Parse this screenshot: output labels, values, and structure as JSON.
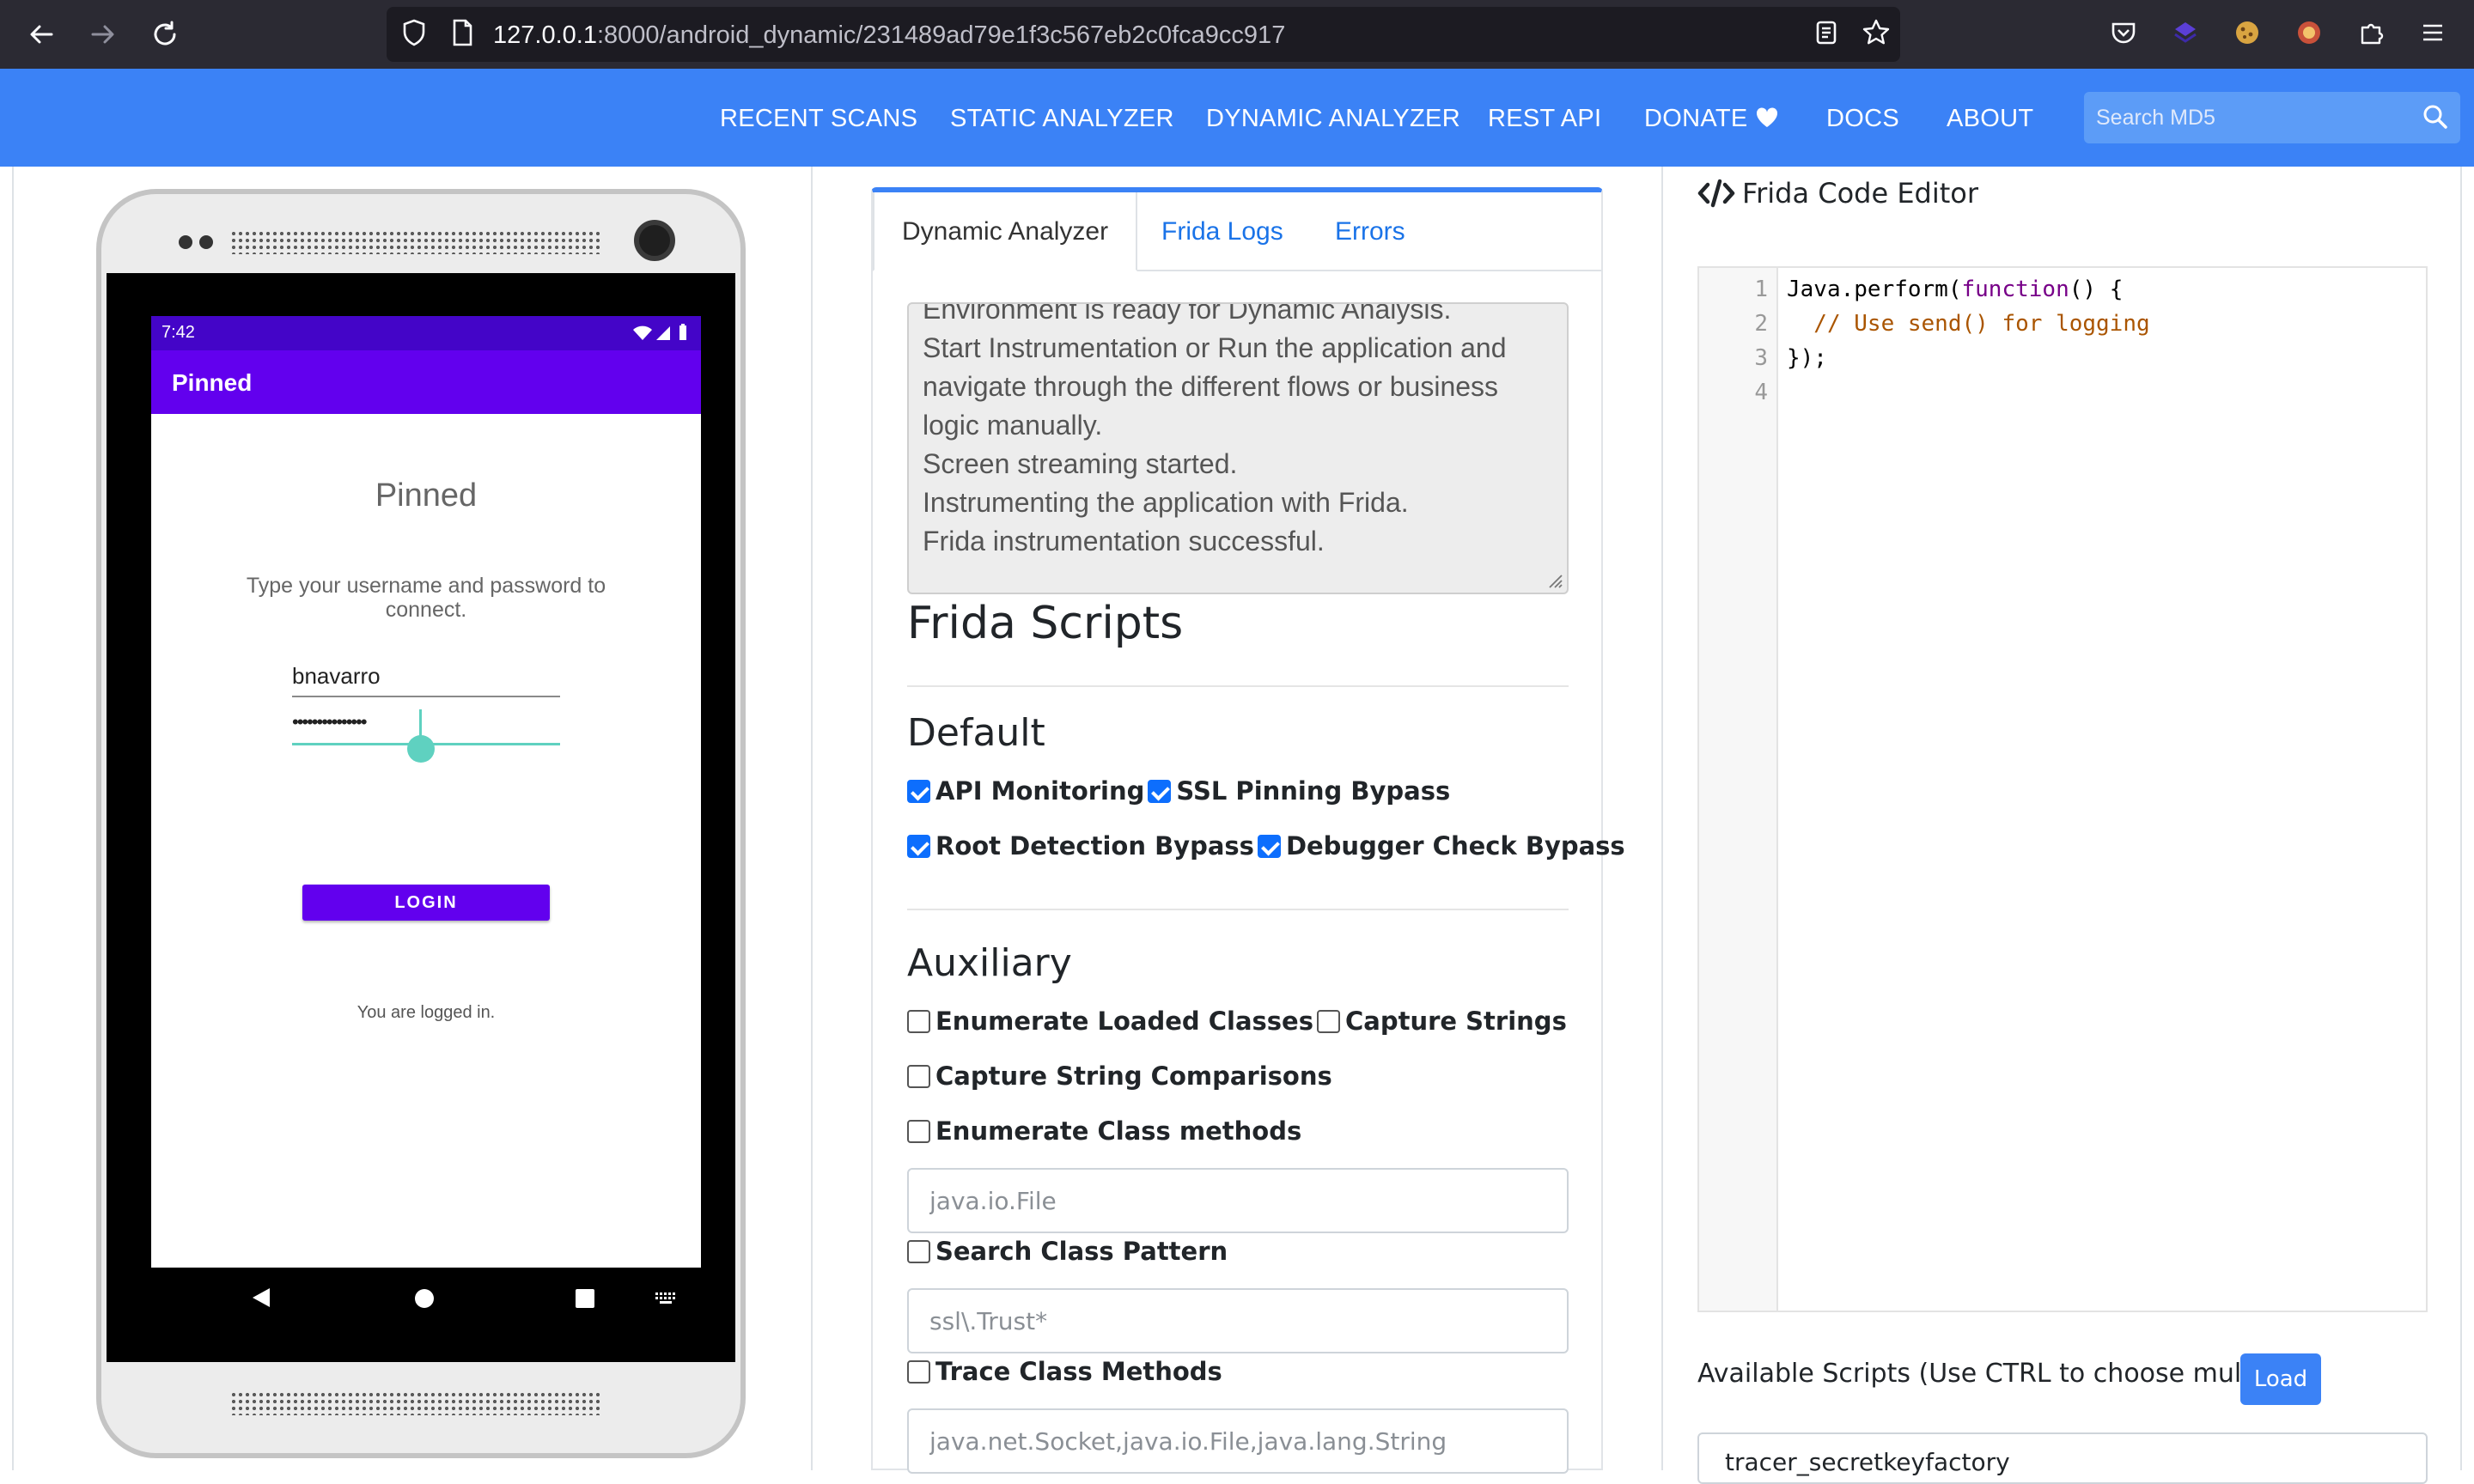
{
  "browser": {
    "url_host": "127.0.0.1",
    "url_path": ":8000/android_dynamic/231489ad79e1f3c567eb2c0fca9cc917"
  },
  "nav": {
    "links": [
      "RECENT SCANS",
      "STATIC ANALYZER",
      "DYNAMIC ANALYZER",
      "REST API",
      "DONATE",
      "DOCS",
      "ABOUT"
    ],
    "search_placeholder": "Search MD5"
  },
  "phone": {
    "time": "7:42",
    "app_bar_title": "Pinned",
    "heading": "Pinned",
    "instructions": "Type your username and password to connect.",
    "username": "bnavarro",
    "password_mask": "•••••••••••••••",
    "login_label": "LOGIN",
    "logged_in_text": "You are logged in."
  },
  "tabs": [
    {
      "label": "Dynamic Analyzer",
      "active": true
    },
    {
      "label": "Frida Logs",
      "active": false
    },
    {
      "label": "Errors",
      "active": false
    }
  ],
  "log": {
    "lines": [
      "Environment is ready for Dynamic Analysis.",
      "Start Instrumentation or Run the application and navigate through the different flows or business logic manually.",
      "Screen streaming started.",
      "Instrumenting the application with Frida.",
      "Frida instrumentation successful."
    ]
  },
  "frida": {
    "title": "Frida Scripts",
    "default_heading": "Default",
    "default_options": [
      {
        "label": "API Monitoring",
        "checked": true
      },
      {
        "label": "SSL Pinning Bypass",
        "checked": true
      },
      {
        "label": "Root Detection Bypass",
        "checked": true
      },
      {
        "label": "Debugger Check Bypass",
        "checked": true
      }
    ],
    "aux_heading": "Auxiliary",
    "aux_options": [
      {
        "label": "Enumerate Loaded Classes",
        "checked": false
      },
      {
        "label": "Capture Strings",
        "checked": false
      },
      {
        "label": "Capture String Comparisons",
        "checked": false
      },
      {
        "label": "Enumerate Class methods",
        "checked": false
      },
      {
        "label": "Search Class Pattern",
        "checked": false
      },
      {
        "label": "Trace Class Methods",
        "checked": false
      }
    ],
    "class_methods_placeholder": "java.io.File",
    "class_pattern_placeholder": "ssl\\.Trust*",
    "trace_placeholder": "java.net.Socket,java.io.File,java.lang.String"
  },
  "editor": {
    "title": "Frida Code Editor",
    "line_numbers": [
      "1",
      "2",
      "3",
      "4"
    ],
    "code_line1_prefix": "Java.perform(",
    "code_line1_keyword": "function",
    "code_line1_suffix": "() {",
    "code_line2": "  // Use send() for logging",
    "code_line3": "});",
    "available_label": "Available Scripts (Use CTRL to choose multiple)",
    "load_label": "Load",
    "first_script": "tracer_secretkeyfactory"
  },
  "colors": {
    "nav_blue": "#3b82f6",
    "android_primary": "#6200ee",
    "android_status": "#4405c8",
    "seekbar_teal": "#5fd1c0",
    "checkbox_blue": "#0d6efd"
  }
}
